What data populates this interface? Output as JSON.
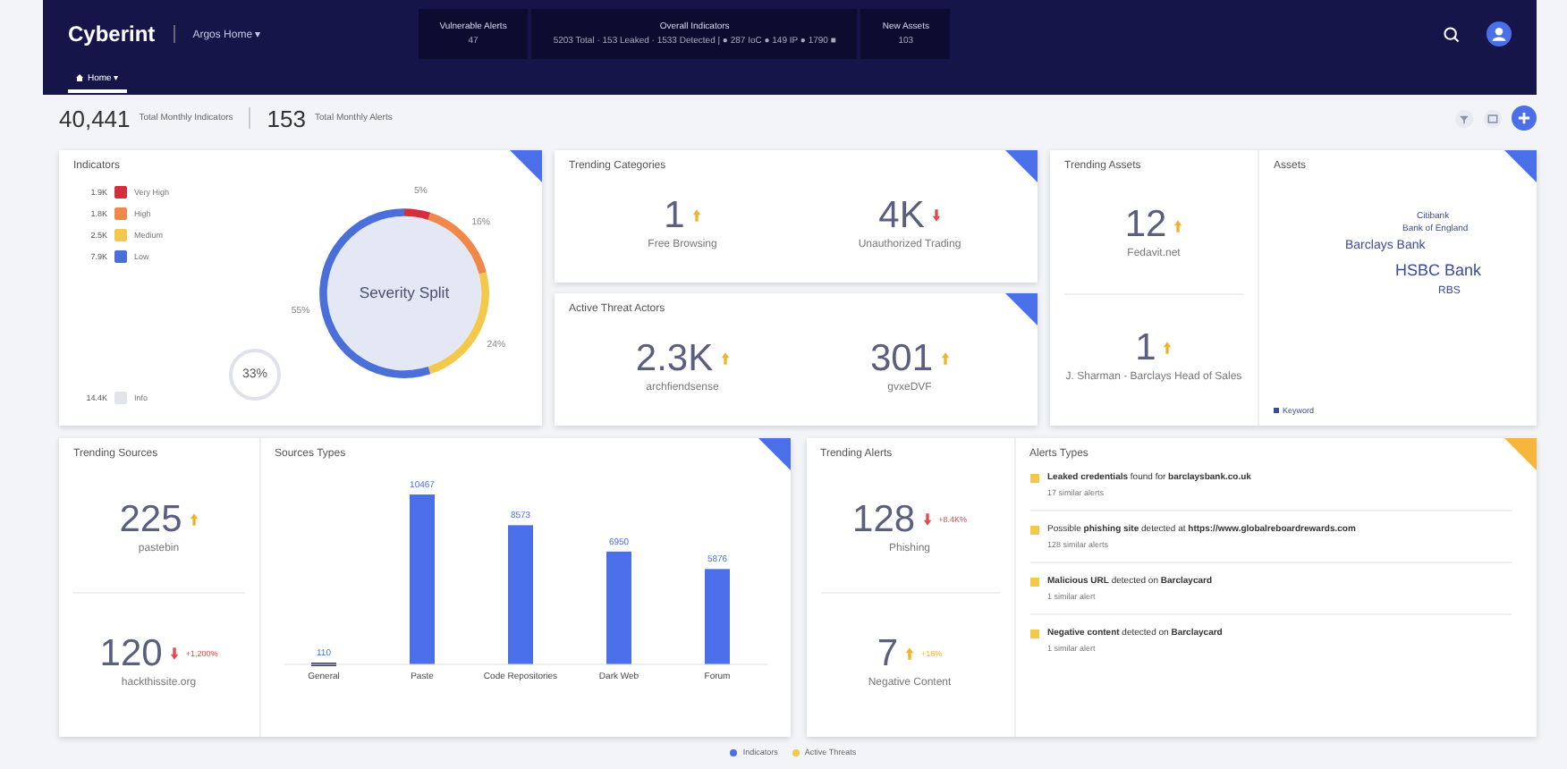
{
  "header": {
    "logo": "Cyberint",
    "workspace": "Argos Home ▾",
    "stats": [
      {
        "label": "Vulnerable Alerts",
        "value": "47"
      },
      {
        "label": "Overall Indicators",
        "value": "5203 Total · 153 Leaked · 1533 Detected | ● 287 IoC ● 149 IP ● 1790 ■"
      },
      {
        "label": "New Assets",
        "value": "103"
      }
    ],
    "tabs": [
      {
        "label": "Home ▾",
        "selected": true
      }
    ]
  },
  "summary": [
    {
      "value": "40,441",
      "label": "Total Monthly Indicators"
    },
    {
      "value": "153",
      "label": "Total Monthly Alerts"
    }
  ],
  "indicators": {
    "title": "Indicators",
    "legend": [
      {
        "count": "1.9K",
        "color": "#d32f3f"
      },
      {
        "count": "1.8K",
        "color": "#f0884a"
      },
      {
        "count": "2.5K",
        "color": "#f4c84a"
      },
      {
        "count": "7.9K",
        "color": "#4a6fd8"
      }
    ],
    "info": {
      "count": "14.4K",
      "label": "Info"
    },
    "ring": {
      "label": "33%"
    },
    "chart_data": {
      "type": "donut",
      "title": "Severity Split",
      "categories": [
        "Very High",
        "High",
        "Medium",
        "Low"
      ],
      "values": [
        5,
        16,
        24,
        55
      ],
      "data_labels": true,
      "value_labels": [
        "5%",
        "16%",
        "24%",
        "55%"
      ]
    }
  },
  "trending_categories": {
    "title": "Trending Categories",
    "items": [
      {
        "value": "1",
        "label": "Free Browsing",
        "rising": true
      },
      {
        "value": "4K",
        "label": "Unauthorized Trading",
        "rising": false
      }
    ]
  },
  "threat_actors": {
    "title": "Active Threat Actors",
    "items": [
      {
        "value": "2.3K",
        "label": "archfiendsense",
        "rising": true
      },
      {
        "value": "301",
        "label": "gvxeDVF",
        "rising": true
      }
    ]
  },
  "trending_assets": {
    "title": "Trending Assets",
    "items": [
      {
        "value": "12",
        "label": "Fedavit.net",
        "rising": true
      },
      {
        "value": "1",
        "label": "J. Sharman - Barclays Head of Sales",
        "rising": true
      }
    ]
  },
  "assets": {
    "title": "Assets",
    "words": [
      "Citibank",
      "Bank of England",
      "Barclays Bank",
      "HSBC Bank",
      "RBS"
    ],
    "legend": "Keyword"
  },
  "trending_sources": {
    "title": "Trending Sources",
    "items": [
      {
        "value": "225",
        "label": "pastebin",
        "rising": true
      },
      {
        "value": "120",
        "label": "hackthissite.org",
        "rising": false,
        "note": "+1,200%"
      }
    ]
  },
  "source_types": {
    "title": "Sources Types",
    "chart_data": {
      "type": "bar",
      "categories": [
        "General",
        "Paste",
        "Code Repositories",
        "Dark Web",
        "Forum"
      ],
      "values": [
        110,
        10467,
        8573,
        6950,
        5876
      ],
      "data_labels": true
    }
  },
  "trending_alerts": {
    "title": "Trending Alerts",
    "items": [
      {
        "value": "128",
        "label": "Phishing",
        "rising": false,
        "note": "+8.4K%"
      },
      {
        "value": "7",
        "label": "Negative Content",
        "rising": true,
        "note": "+16%"
      }
    ]
  },
  "alert_types": {
    "title": "Alerts Types",
    "items": [
      {
        "text": "**Leaked credentials** found for **barclaysbank.co.uk**",
        "sub": "17 similar alerts"
      },
      {
        "text": "Possible **phishing site** detected at **https://www.globalreboardrewards.com**",
        "sub": "128 similar alerts"
      },
      {
        "text": "**Malicious URL** detected on **Barclaycard**",
        "sub": "1 similar alert"
      },
      {
        "text": "**Negative content** detected on **Barclaycard**",
        "sub": "1 similar alert"
      }
    ]
  },
  "legend": [
    {
      "label": "Indicators",
      "color": "#4a6fe8"
    },
    {
      "label": "Active Threats",
      "color": "#f4c84a"
    }
  ]
}
